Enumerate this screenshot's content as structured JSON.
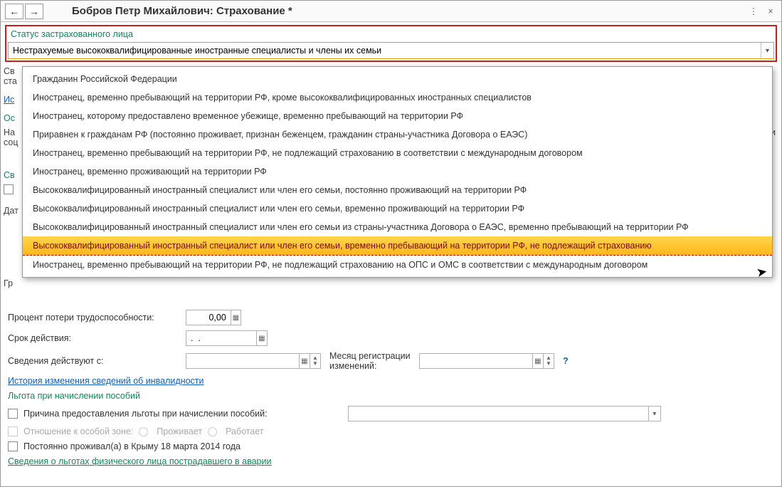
{
  "title": "Бобров Петр Михайлович: Страхование *",
  "statusLabel": "Статус застрахованного лица",
  "statusValue": "Нестрахуемые высококвалифицированные иностранные специалисты и члены их семьи",
  "dropdown": {
    "items": [
      "Гражданин Российской Федерации",
      "Иностранец, временно пребывающий на территории РФ, кроме высококвалифицированных иностранных специалистов",
      "Иностранец, которому предоставлено временное убежище, временно пребывающий на территории РФ",
      "Приравнен к гражданам РФ (постоянно проживает, признан беженцем, гражданин страны-участника Договора о ЕАЭС)",
      "Иностранец, временно пребывающий на территории РФ, не подлежащий страхованию в соответствии с международным договором",
      "Иностранец, временно проживающий на территории РФ",
      "Высококвалифицированный иностранный специалист или член его семьи, постоянно проживающий на территории РФ",
      "Высококвалифицированный иностранный специалист или член его семьи, временно проживающий на территории РФ",
      "Высококвалифицированный иностранный специалист или член его семьи из страны-участника Договора о ЕАЭС, временно пребывающий на территории РФ",
      "Высококвалифицированный иностранный специалист или член его семьи, временно пребывающий на территории РФ, не подлежащий страхованию",
      "Иностранец, временно пребывающий на территории РФ, не подлежащий страхованию на ОПС и ОМС в соответствии с международным договором"
    ],
    "highlightIndex": 9
  },
  "behind": {
    "svLine1": "Св",
    "svLine2": "ста",
    "isLine": "Ис",
    "osLine": "Ос",
    "naLine": "На",
    "socLine": "соц",
    "iChar": "и",
    "svEmpty": "Св",
    "emptyBox": "",
    "datLine": "Дат",
    "grLine": "Гр"
  },
  "form": {
    "percentLabel": "Процент потери трудоспособности:",
    "percentValue": "0,00",
    "periodLabel": "Срок действия:",
    "periodValue": ".  .",
    "fromLabel": "Сведения действуют с:",
    "fromValue": "",
    "monthLabel": "Месяц регистрации изменений:",
    "monthValue": "",
    "historyLink": "История изменения сведений об инвалидности",
    "benefitHeader": "Льгота при начислении пособий",
    "reasonLabel": "Причина предоставления льготы при начислении пособий:",
    "zoneLabel": "Отношение к особой зоне:",
    "zoneOpt1": "Проживает",
    "zoneOpt2": "Работает",
    "crimeaLabel": "Постоянно проживал(а) в Крыму 18 марта 2014 года",
    "accidentLink": "Сведения о льготах физического лица пострадавшего в аварии"
  }
}
